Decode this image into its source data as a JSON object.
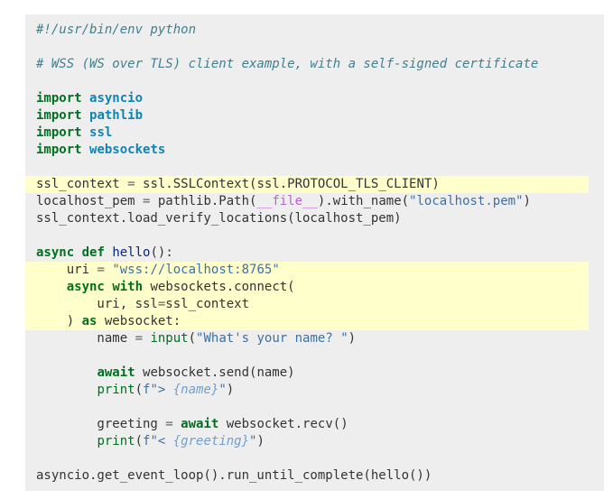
{
  "code": {
    "l1": "#!/usr/bin/env python",
    "l3": "# WSS (WS over TLS) client example, with a self-signed certificate",
    "import_kw": "import",
    "mod_asyncio": "asyncio",
    "mod_pathlib": "pathlib",
    "mod_ssl": "ssl",
    "mod_websockets": "websockets",
    "l9a": "ssl_context ",
    "eq": "=",
    "l9b": " ssl.SSLContext(ssl.PROTOCOL_TLS_CLIENT)",
    "l10a": "localhost_pem ",
    "l10b": " pathlib.Path(",
    "dunder_file": "__file__",
    "l10c": ").with_name(",
    "l10str": "\"localhost.pem\"",
    "l10d": ")",
    "l11": "ssl_context.load_verify_locations(localhost_pem)",
    "kw_async": "async",
    "kw_def": "def",
    "fn_hello": "hello",
    "l13rest": "():",
    "l14a": "    uri ",
    "l14str": "\"wss://localhost:8765\"",
    "indent4": "    ",
    "kw_with": "with",
    "l15rest": " websockets.connect(",
    "l16a": "        uri, ssl",
    "l16b": "ssl_context",
    "l17a": "    ) ",
    "kw_as": "as",
    "l17b": " websocket:",
    "l18a": "        name ",
    "fn_input": "input",
    "l18str": "\"What's your name? \"",
    "close_paren": ")",
    "indent8": "        ",
    "kw_await": "await",
    "l20rest": " websocket.send(name)",
    "fn_print": "print",
    "open_paren": "(",
    "l21s1": "f\"> ",
    "l22s1": "f\"< ",
    "interp_name": "{name}",
    "interp_greeting": "{greeting}",
    "dquote": "\"",
    "l23a": "        greeting ",
    "l23rest": " websocket.recv()",
    "l26": "asyncio.get_event_loop().run_until_complete(hello())"
  }
}
